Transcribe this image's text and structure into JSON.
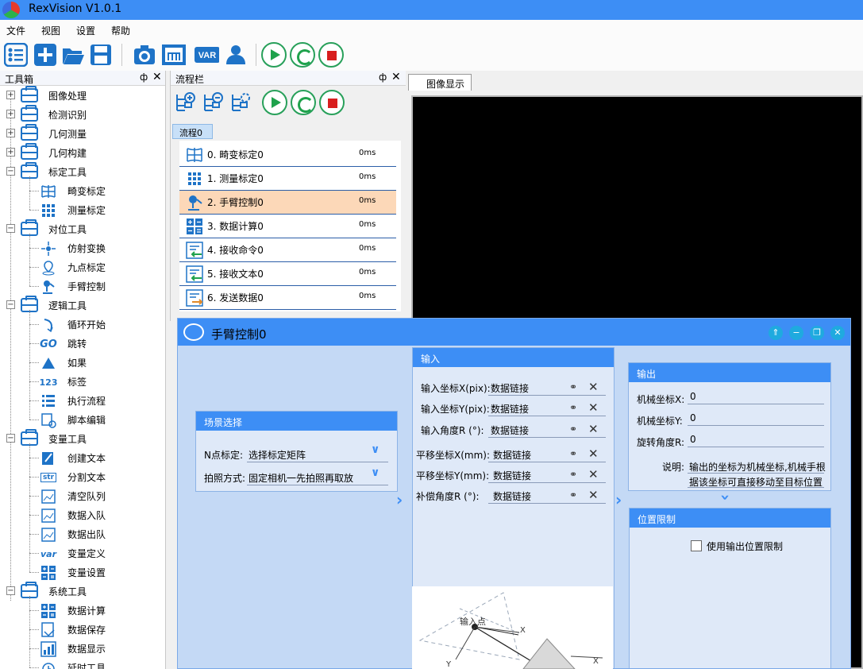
{
  "app": {
    "title": "RexVision V1.0.1"
  },
  "menu": {
    "items": [
      "文件",
      "视图",
      "设置",
      "帮助"
    ]
  },
  "toolbar": {
    "var_label": "VAR"
  },
  "toolbox": {
    "title": "工具箱",
    "pin_glyph": "ф",
    "close_glyph": "✕",
    "groups": [
      {
        "label": "图像处理",
        "expanded": false
      },
      {
        "label": "检测识别",
        "expanded": false
      },
      {
        "label": "几何测量",
        "expanded": false
      },
      {
        "label": "几何构建",
        "expanded": false
      },
      {
        "label": "标定工具",
        "expanded": true,
        "children": [
          "畸变标定",
          "测量标定"
        ]
      },
      {
        "label": "对位工具",
        "expanded": true,
        "children": [
          "仿射变换",
          "九点标定",
          "手臂控制"
        ]
      },
      {
        "label": "逻辑工具",
        "expanded": true,
        "children": [
          "循环开始",
          "跳转",
          "如果",
          "标签",
          "执行流程",
          "脚本编辑"
        ]
      },
      {
        "label": "变量工具",
        "expanded": true,
        "children": [
          "创建文本",
          "分割文本",
          "清空队列",
          "数据入队",
          "数据出队",
          "变量定义",
          "变量设置"
        ]
      },
      {
        "label": "系统工具",
        "expanded": true,
        "children": [
          "数据计算",
          "数据保存",
          "数据显示",
          "延时工具"
        ]
      }
    ],
    "icon_texts": {
      "go": "GO",
      "num": "123",
      "str": "str",
      "var": "var"
    }
  },
  "flowbar": {
    "title": "流程栏",
    "pin_glyph": "ф",
    "close_glyph": "✕",
    "tab": "流程0",
    "steps": [
      {
        "name": "0. 畸变标定0",
        "time": "0ms",
        "selected": false
      },
      {
        "name": "1. 测量标定0",
        "time": "0ms",
        "selected": false
      },
      {
        "name": "2. 手臂控制0",
        "time": "0ms",
        "selected": true
      },
      {
        "name": "3. 数据计算0",
        "time": "0ms",
        "selected": false
      },
      {
        "name": "4. 接收命令0",
        "time": "0ms",
        "selected": false
      },
      {
        "name": "5. 接收文本0",
        "time": "0ms",
        "selected": false
      },
      {
        "name": "6. 发送数据0",
        "time": "0ms",
        "selected": false
      }
    ]
  },
  "image_display": {
    "tab": "图像显示"
  },
  "dialog": {
    "title": "手臂控制0",
    "scene": {
      "title": "场景选择",
      "n_point_label": "N点标定:",
      "n_point_value": "选择标定矩阵",
      "shoot_label": "拍照方式:",
      "shoot_value": "固定相机一先拍照再取放"
    },
    "input": {
      "title": "输入",
      "link_text": "数据链接",
      "rows": [
        "输入坐标X(pix):",
        "输入坐标Y(pix):",
        "输入角度R  (°):",
        "平移坐标X(mm):",
        "平移坐标Y(mm):",
        "补偿角度R  (°):"
      ]
    },
    "output": {
      "title": "输出",
      "rows": [
        {
          "label": "机械坐标X:",
          "value": "0"
        },
        {
          "label": "机械坐标Y:",
          "value": "0"
        },
        {
          "label": "旋转角度R:",
          "value": "0"
        }
      ],
      "note_label": "说明:",
      "note_line1": "输出的坐标为机械坐标,机械手根",
      "note_line2": "据该坐标可直接移动至目标位置"
    },
    "limit": {
      "title": "位置限制",
      "checkbox_label": "使用输出位置限制",
      "checked": false
    },
    "diagram": {
      "point_label": "输入点",
      "x_axis": "X",
      "y_axis": "Y"
    },
    "buttons": {
      "pin": "⇑",
      "min": "−",
      "restore": "❐",
      "close": "✕"
    }
  }
}
